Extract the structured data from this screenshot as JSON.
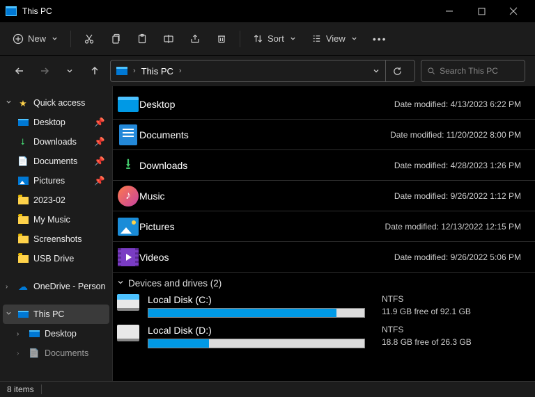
{
  "window": {
    "title": "This PC"
  },
  "toolbar": {
    "new": "New",
    "sort": "Sort",
    "view": "View"
  },
  "address": {
    "crumb": "This PC"
  },
  "search": {
    "placeholder": "Search This PC"
  },
  "sidebar": {
    "quick": "Quick access",
    "items": [
      {
        "label": "Desktop",
        "pin": true
      },
      {
        "label": "Downloads",
        "pin": true
      },
      {
        "label": "Documents",
        "pin": true
      },
      {
        "label": "Pictures",
        "pin": true
      },
      {
        "label": "2023-02",
        "pin": false
      },
      {
        "label": "My Music",
        "pin": false
      },
      {
        "label": "Screenshots",
        "pin": false
      },
      {
        "label": "USB Drive",
        "pin": false
      }
    ],
    "onedrive": "OneDrive - Person",
    "thispc": "This PC",
    "desktop": "Desktop",
    "documents": "Documents"
  },
  "folders": [
    {
      "name": "Desktop",
      "meta": "Date modified: 4/13/2023 6:22 PM"
    },
    {
      "name": "Documents",
      "meta": "Date modified: 11/20/2022 8:00 PM"
    },
    {
      "name": "Downloads",
      "meta": "Date modified: 4/28/2023 1:26 PM"
    },
    {
      "name": "Music",
      "meta": "Date modified: 9/26/2022 1:12 PM"
    },
    {
      "name": "Pictures",
      "meta": "Date modified: 12/13/2022 12:15 PM"
    },
    {
      "name": "Videos",
      "meta": "Date modified: 9/26/2022 5:06 PM"
    }
  ],
  "group": {
    "label": "Devices and drives (2)"
  },
  "drives": [
    {
      "name": "Local Disk (C:)",
      "fs": "NTFS",
      "free": "11.9 GB free of 92.1 GB",
      "pct": 87
    },
    {
      "name": "Local Disk (D:)",
      "fs": "NTFS",
      "free": "18.8 GB free of 26.3 GB",
      "pct": 28
    }
  ],
  "status": {
    "items": "8 items"
  }
}
